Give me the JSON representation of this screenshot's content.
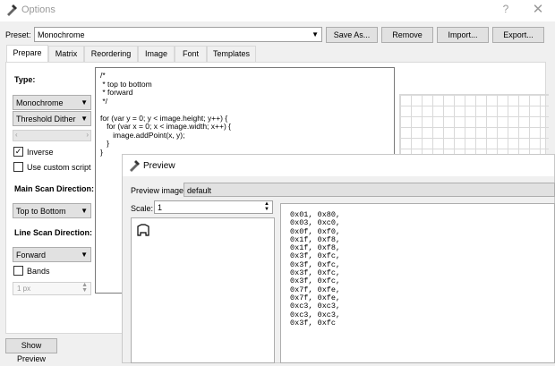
{
  "window": {
    "title": "Options",
    "help": "?",
    "close": "✕"
  },
  "preset": {
    "label": "Preset:",
    "value": "Monochrome",
    "buttons": {
      "save_as": "Save As...",
      "remove": "Remove",
      "import": "Import...",
      "export": "Export..."
    }
  },
  "tabs": [
    "Prepare",
    "Matrix",
    "Reordering",
    "Image",
    "Font",
    "Templates"
  ],
  "prepare": {
    "type_label": "Type:",
    "type_value": "Monochrome",
    "dither_value": "Threshold Dither",
    "inverse_label": "Inverse",
    "inverse_checked": true,
    "custom_script_label": "Use custom script",
    "custom_script_checked": false,
    "main_scan_label": "Main Scan Direction:",
    "main_scan_value": "Top to Bottom",
    "line_scan_label": "Line Scan Direction:",
    "line_scan_value": "Forward",
    "bands_label": "Bands",
    "bands_checked": false,
    "bands_size": "1 px",
    "show_preview": "Show Preview",
    "script_lines": [
      "/*",
      " * top to bottom",
      " * forward",
      " */",
      "",
      "for (var y = 0; y < image.height; y++) {",
      "   for (var x = 0; x < image.width; x++) {",
      "      image.addPoint(x, y);",
      "   }",
      "}"
    ]
  },
  "preview": {
    "title": "Preview",
    "image_label": "Preview image:",
    "image_value": "default",
    "scale_label": "Scale:",
    "scale_value": "1",
    "hex_lines": [
      "0x01, 0x80,",
      "0x03, 0xc0,",
      "0x0f, 0xf0,",
      "0x1f, 0xf8,",
      "0x1f, 0xf8,",
      "0x3f, 0xfc,",
      "0x3f, 0xfc,",
      "0x3f, 0xfc,",
      "0x3f, 0xfc,",
      "0x7f, 0xfe,",
      "0x7f, 0xfe,",
      "0xc3, 0xc3,",
      "0xc3, 0xc3,",
      "0x3f, 0xfc"
    ]
  }
}
